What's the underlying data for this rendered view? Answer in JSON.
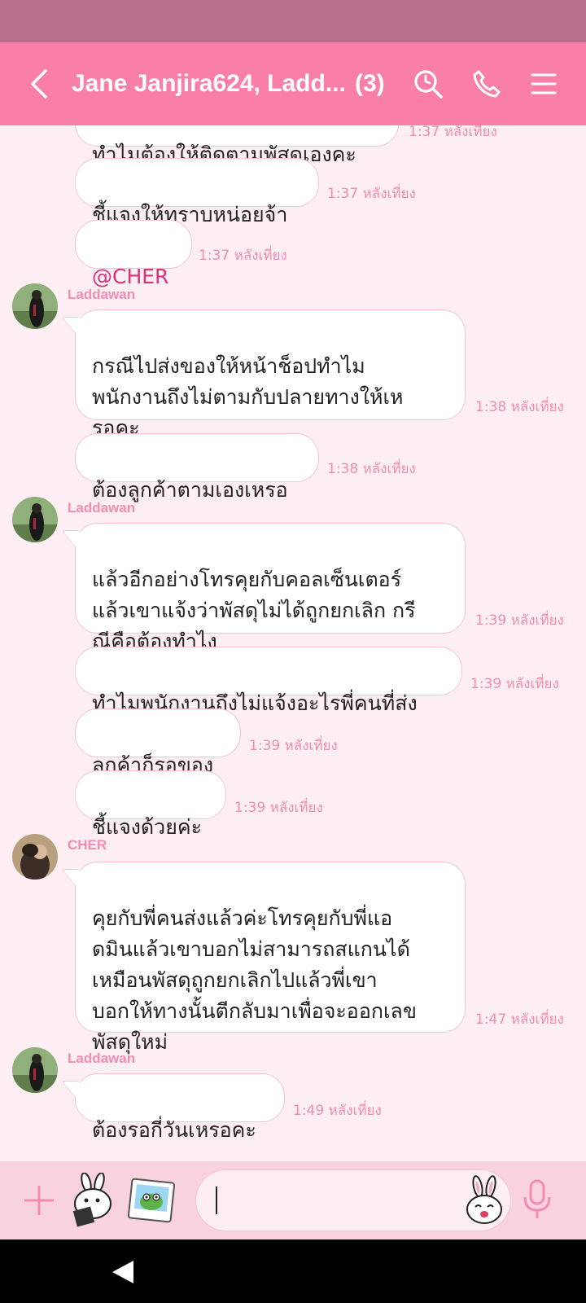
{
  "header": {
    "title": "Jane Janjira624, Ladd...",
    "member_count": "(3)"
  },
  "icons": {
    "back": "chevron-left-icon",
    "search": "search-icon",
    "call": "phone-icon",
    "menu": "hamburger-menu-icon",
    "add": "plus-icon",
    "sticker": "sticker-icon",
    "gallery": "photo-icon",
    "emoji": "emoji-icon",
    "mic": "microphone-icon"
  },
  "colors": {
    "header": "#f97fa8",
    "statusbar": "#b86f8c",
    "background": "#fdeef3",
    "accent": "#f28db1",
    "mention": "#d6337a"
  },
  "messages": [
    {
      "text": "ทำไมต้องให้ติดตามพัสดุเองคะ",
      "time": "1:37 หลังเที่ยง"
    },
    {
      "text": "ชี้แจงให้ทราบหน่อยจ้า",
      "time": "1:37 หลังเที่ยง"
    },
    {
      "text": "@CHER",
      "time": "1:37 หลังเที่ยง"
    },
    {
      "sender": "Laddawan",
      "text": "กรณีไปส่งของให้หน้าช็อปทำไม\nพนักงานถึงไม่ตามกับปลายทางให้เห\nรอคะ",
      "time": "1:38 หลังเที่ยง"
    },
    {
      "text": "ต้องลูกค้าตามเองเหรอ",
      "time": "1:38 หลังเที่ยง"
    },
    {
      "sender": "Laddawan",
      "text": "แล้วอีกอย่างโทรคุยกับคอลเซ็นเตอร์\nแล้วเขาแจ้งว่าพัสดุไม่ได้ถูกยกเลิก กรี\nณีคือต้องทำไง",
      "time": "1:39 หลังเที่ยง"
    },
    {
      "text": "ทำไมพนักงานถึงไม่แจ้งอะไรพี่คนที่ส่ง",
      "time": "1:39 หลังเที่ยง"
    },
    {
      "text": "ลูกค้าก็รอของ",
      "time": "1:39 หลังเที่ยง"
    },
    {
      "text": "ชี้แจงด้วยค่ะ",
      "time": "1:39 หลังเที่ยง"
    },
    {
      "sender": "CHER",
      "text": "คุยกับพี่คนส่งแล้วค่ะโทรคุยกับพี่แอ\nดมินแล้วเขาบอกไม่สามารถสแกนได้\nเหมือนพัสดุถูกยกเลิกไปแล้วพี่เขา\nบอกให้ทางนั้นตีกลับมาเพื่อจะออกเลข\nพัสดุใหม่",
      "time": "1:47 หลังเที่ยง"
    },
    {
      "sender": "Laddawan",
      "text": "ต้องรอกี่วันเหรอคะ",
      "time": "1:49 หลังเที่ยง"
    }
  ]
}
